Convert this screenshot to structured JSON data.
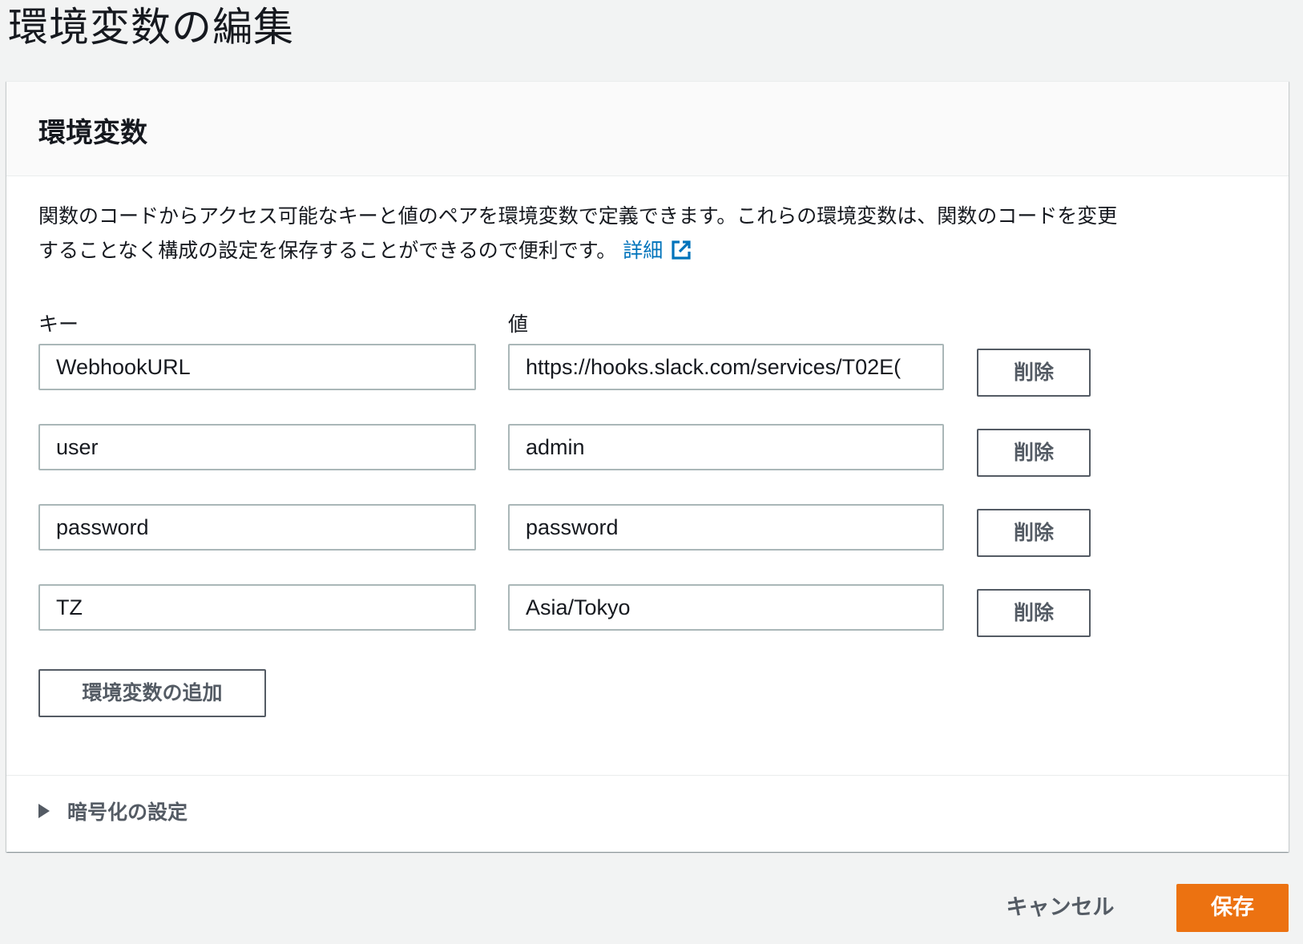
{
  "page": {
    "title": "環境変数の編集"
  },
  "panel": {
    "title": "環境変数",
    "description_line1": "関数のコードからアクセス可能なキーと値のペアを環境変数で定義できます。これらの環境変数は、関数のコードを変更",
    "description_line2": "することなく構成の設定を保存することができるので便利です。",
    "learn_more_label": "詳細",
    "learn_more_icon": "external-link-icon",
    "key_column_label": "キー",
    "value_column_label": "値",
    "rows": [
      {
        "key": "WebhookURL",
        "value": "https://hooks.slack.com/services/T02E("
      },
      {
        "key": "user",
        "value": "admin"
      },
      {
        "key": "password",
        "value": "password"
      },
      {
        "key": "TZ",
        "value": "Asia/Tokyo"
      }
    ],
    "remove_label": "削除",
    "add_label": "環境変数の追加",
    "encryption_label": "暗号化の設定",
    "encryption_icon": "caret-right-icon"
  },
  "footer": {
    "cancel_label": "キャンセル",
    "save_label": "保存"
  },
  "colors": {
    "primary": "#ec7211",
    "link": "#0073bb",
    "border": "#aab7b8",
    "button_text": "#545b64",
    "background": "#f2f3f3"
  }
}
